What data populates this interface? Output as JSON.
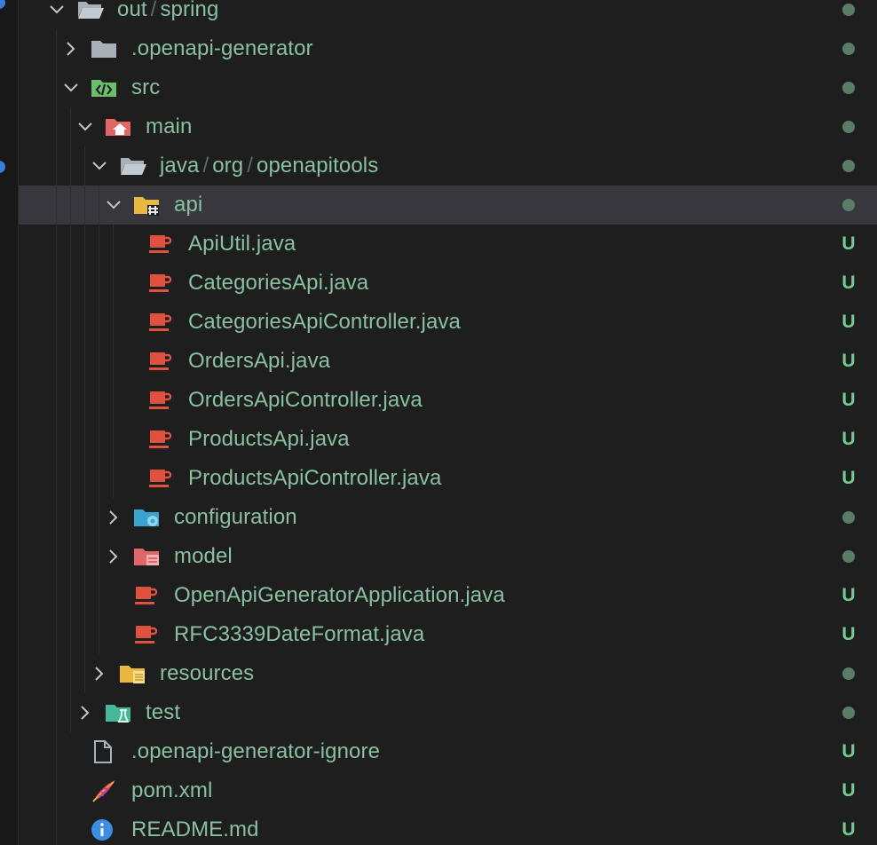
{
  "explorer": {
    "items": [
      {
        "id": "out-spring",
        "label_parts": [
          "out",
          "spring"
        ],
        "depth": 0,
        "kind": "folder",
        "expanded": true,
        "icon": "folder-open-icon",
        "status": "dot"
      },
      {
        "id": "openapi-generator",
        "label": ".openapi-generator",
        "depth": 1,
        "kind": "folder",
        "expanded": false,
        "icon": "folder-icon",
        "status": "dot"
      },
      {
        "id": "src",
        "label": "src",
        "depth": 1,
        "kind": "folder",
        "expanded": true,
        "icon": "source-folder-icon",
        "status": "dot"
      },
      {
        "id": "main",
        "label": "main",
        "depth": 2,
        "kind": "folder",
        "expanded": true,
        "icon": "home-folder-icon",
        "status": "dot"
      },
      {
        "id": "java-org-openapitools",
        "label_parts": [
          "java",
          "org",
          "openapitools"
        ],
        "depth": 3,
        "kind": "folder",
        "expanded": true,
        "icon": "folder-open-icon",
        "status": "dot"
      },
      {
        "id": "api",
        "label": "api",
        "depth": 4,
        "kind": "folder",
        "expanded": true,
        "icon": "api-folder-icon",
        "status": "dot",
        "selected": true
      },
      {
        "id": "apiutil-java",
        "label": "ApiUtil.java",
        "depth": 5,
        "kind": "file",
        "icon": "java-file-icon",
        "status": "U"
      },
      {
        "id": "categoriesapi-java",
        "label": "CategoriesApi.java",
        "depth": 5,
        "kind": "file",
        "icon": "java-file-icon",
        "status": "U"
      },
      {
        "id": "categoriesapicontroller-java",
        "label": "CategoriesApiController.java",
        "depth": 5,
        "kind": "file",
        "icon": "java-file-icon",
        "status": "U"
      },
      {
        "id": "ordersapi-java",
        "label": "OrdersApi.java",
        "depth": 5,
        "kind": "file",
        "icon": "java-file-icon",
        "status": "U"
      },
      {
        "id": "ordersapicontroller-java",
        "label": "OrdersApiController.java",
        "depth": 5,
        "kind": "file",
        "icon": "java-file-icon",
        "status": "U"
      },
      {
        "id": "productsapi-java",
        "label": "ProductsApi.java",
        "depth": 5,
        "kind": "file",
        "icon": "java-file-icon",
        "status": "U"
      },
      {
        "id": "productsapicontroller-java",
        "label": "ProductsApiController.java",
        "depth": 5,
        "kind": "file",
        "icon": "java-file-icon",
        "status": "U"
      },
      {
        "id": "configuration",
        "label": "configuration",
        "depth": 4,
        "kind": "folder",
        "expanded": false,
        "icon": "config-folder-icon",
        "status": "dot"
      },
      {
        "id": "model",
        "label": "model",
        "depth": 4,
        "kind": "folder",
        "expanded": false,
        "icon": "model-folder-icon",
        "status": "dot"
      },
      {
        "id": "openapigeneratorapplication-java",
        "label": "OpenApiGeneratorApplication.java",
        "depth": 4,
        "kind": "file",
        "icon": "java-file-icon",
        "status": "U"
      },
      {
        "id": "rfc3339dateformat-java",
        "label": "RFC3339DateFormat.java",
        "depth": 4,
        "kind": "file",
        "icon": "java-file-icon",
        "status": "U"
      },
      {
        "id": "resources",
        "label": "resources",
        "depth": 3,
        "kind": "folder",
        "expanded": false,
        "icon": "resources-folder-icon",
        "status": "dot"
      },
      {
        "id": "test",
        "label": "test",
        "depth": 2,
        "kind": "folder",
        "expanded": false,
        "icon": "test-folder-icon",
        "status": "dot"
      },
      {
        "id": "openapi-generator-ignore",
        "label": ".openapi-generator-ignore",
        "depth": 1,
        "kind": "file",
        "icon": "file-icon",
        "status": "U"
      },
      {
        "id": "pom-xml",
        "label": "pom.xml",
        "depth": 1,
        "kind": "file",
        "icon": "maven-feather-icon",
        "status": "U"
      },
      {
        "id": "readme-md",
        "label": "README.md",
        "depth": 1,
        "kind": "file",
        "icon": "info-icon",
        "status": "U"
      }
    ]
  },
  "colors": {
    "background": "#1e1e1f",
    "selected_row": "#37373d",
    "label_untracked": "#88c0a0",
    "status_untracked": "#73c991",
    "status_dot": "#5b7c66",
    "java_icon": "#e0513f"
  }
}
